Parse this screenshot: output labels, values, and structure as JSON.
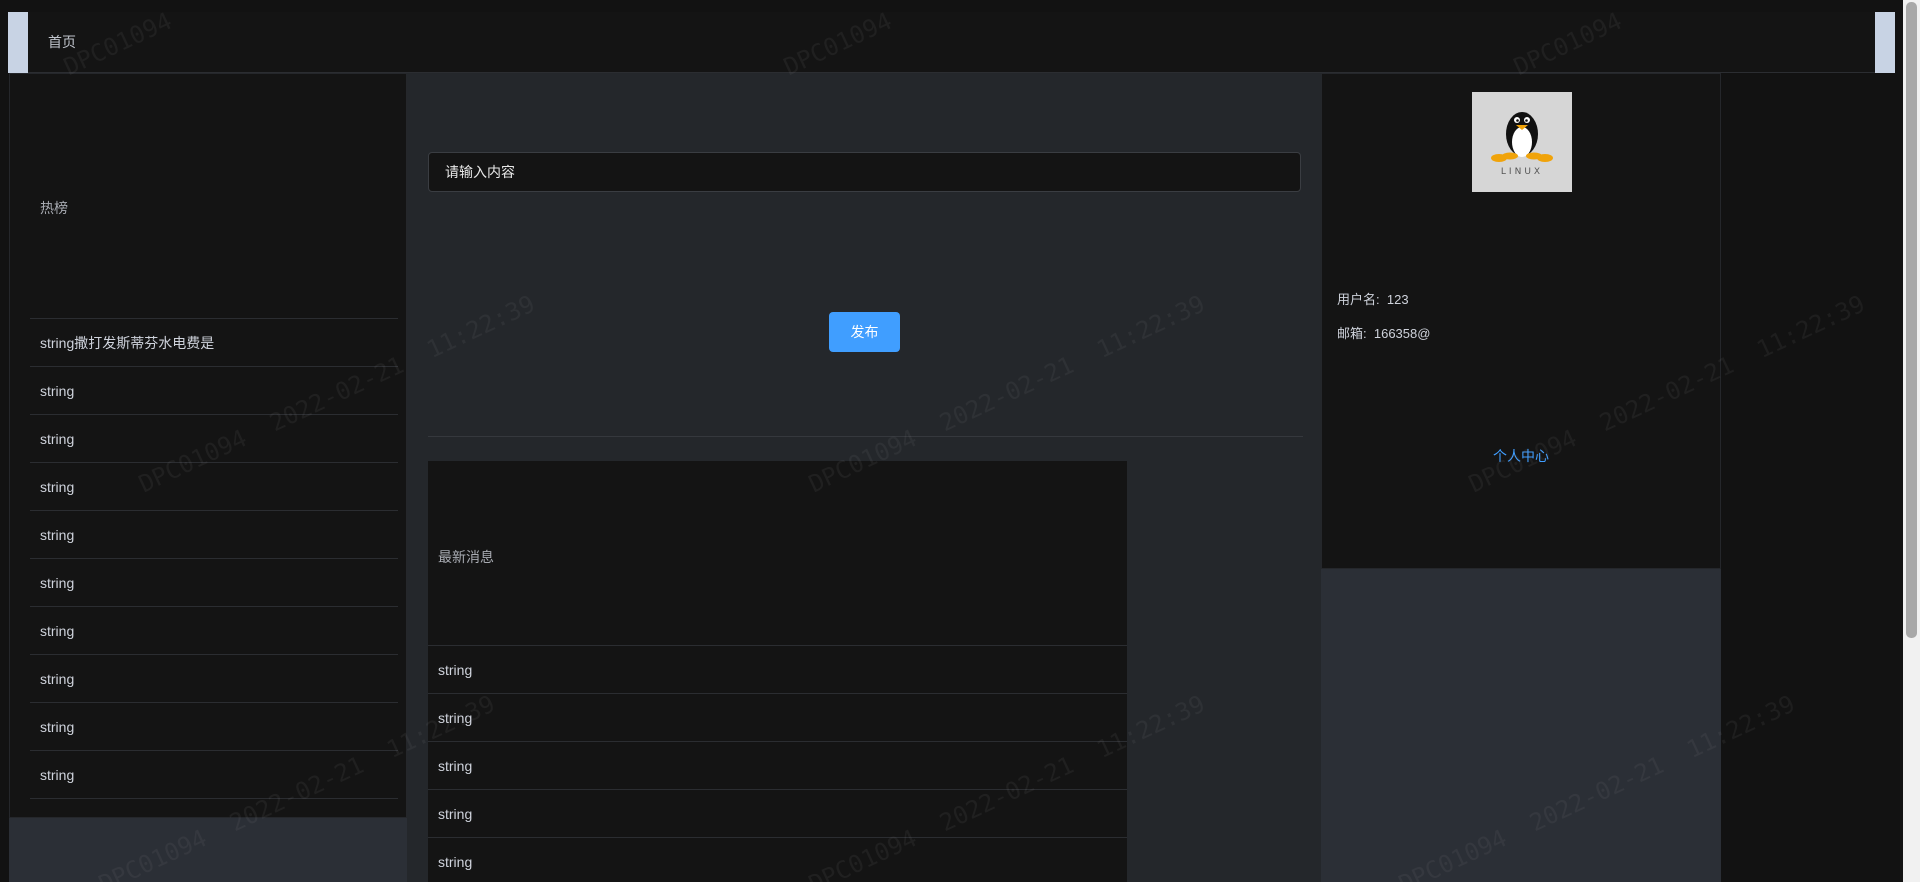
{
  "header": {
    "nav_home": "首页"
  },
  "hot": {
    "title": "热榜",
    "items": [
      "string撒打发斯蒂芬水电费是",
      "string",
      "string",
      "string",
      "string",
      "string",
      "string",
      "string",
      "string",
      "string"
    ]
  },
  "post": {
    "placeholder": "请输入内容",
    "publish_label": "发布"
  },
  "news": {
    "title": "最新消息",
    "items": [
      "string",
      "string",
      "string",
      "string",
      "string"
    ]
  },
  "profile": {
    "avatar_text": "LINUX",
    "username_label": "用户名:",
    "username": "123",
    "email_label": "邮箱:",
    "email": "166358@",
    "personal_center": "个人中心"
  },
  "watermark": {
    "id": "DPC01094",
    "date": "2022-02-21",
    "time": "11:22:39"
  },
  "colors": {
    "accent": "#409eff",
    "background": "#121212",
    "panel": "#141414"
  }
}
